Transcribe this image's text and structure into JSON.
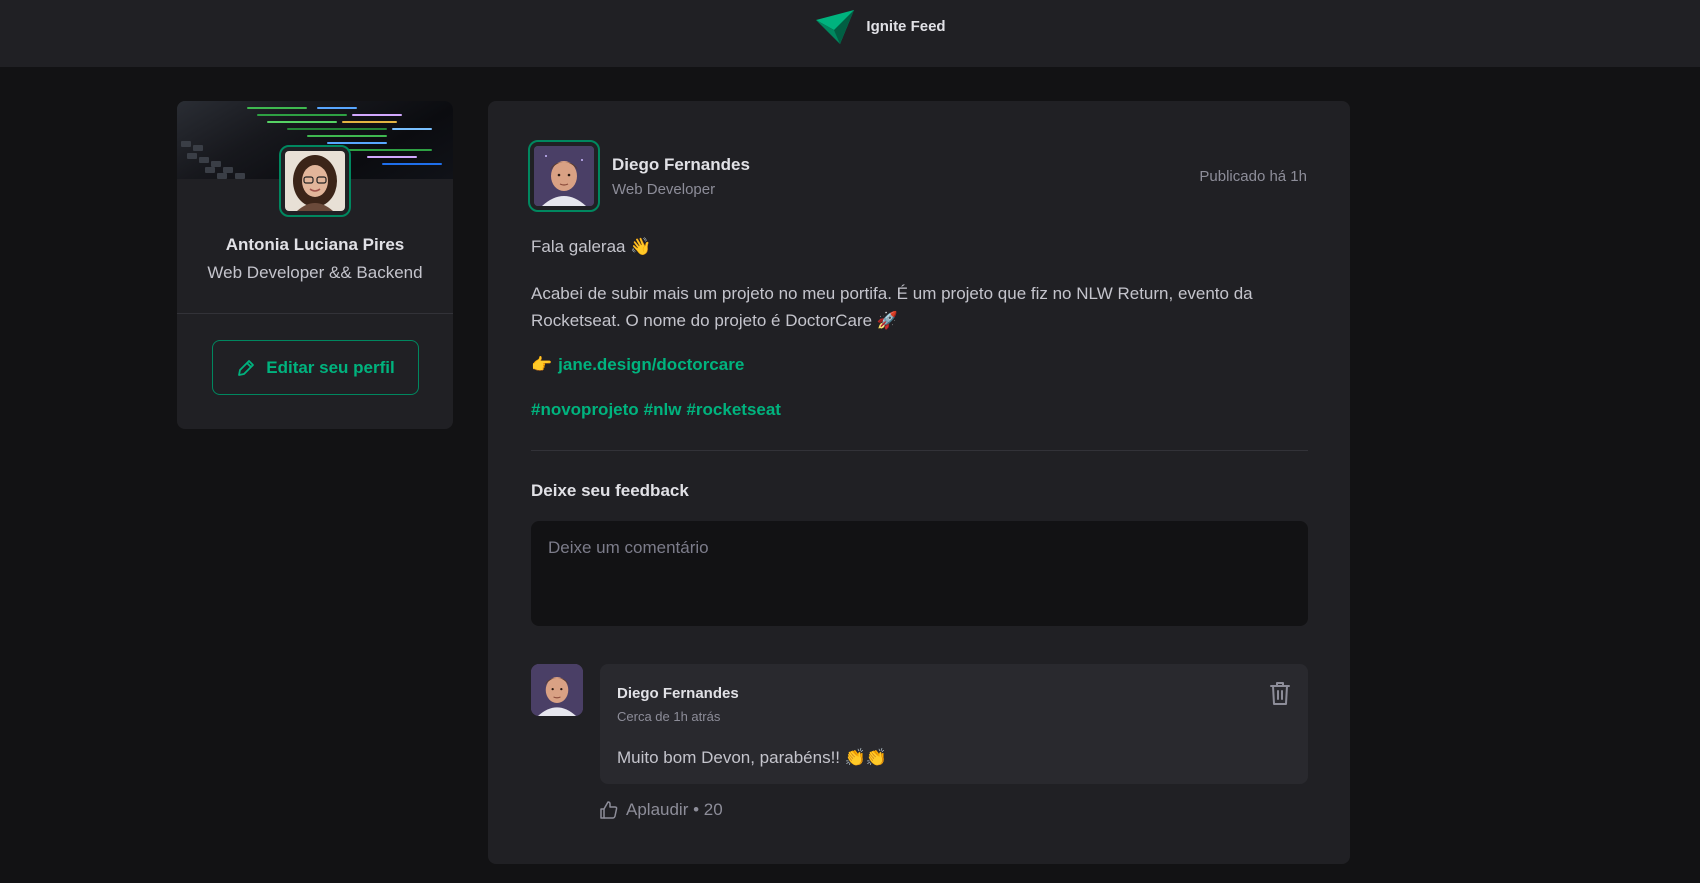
{
  "header": {
    "title": "Ignite Feed"
  },
  "sidebar": {
    "name": "Antonia Luciana Pires",
    "role": "Web Developer && Backend",
    "edit_button_label": "Editar seu perfil"
  },
  "post": {
    "author_name": "Diego Fernandes",
    "author_role": "Web Developer",
    "published_label": "Publicado há 1h",
    "greeting": "Fala galeraa 👋",
    "body": "Acabei de subir mais um projeto no meu portifa. É um projeto que fiz no NLW Return, evento da Rocketseat. O nome do projeto é DoctorCare 🚀",
    "link_emoji": "👉",
    "link_text": "jane.design/doctorcare",
    "hashtags": [
      "#novoprojeto",
      "#nlw",
      "#rocketseat"
    ]
  },
  "feedback": {
    "title": "Deixe seu feedback",
    "placeholder": "Deixe um comentário"
  },
  "comment": {
    "author": "Diego Fernandes",
    "time": "Cerca de 1h atrás",
    "text": "Muito bom Devon, parabéns!! 👏👏",
    "applaud_label": "Aplaudir • 20"
  },
  "colors": {
    "accent": "#00875f",
    "accent_light": "#00b37e",
    "background": "#121214",
    "card": "#202024"
  }
}
